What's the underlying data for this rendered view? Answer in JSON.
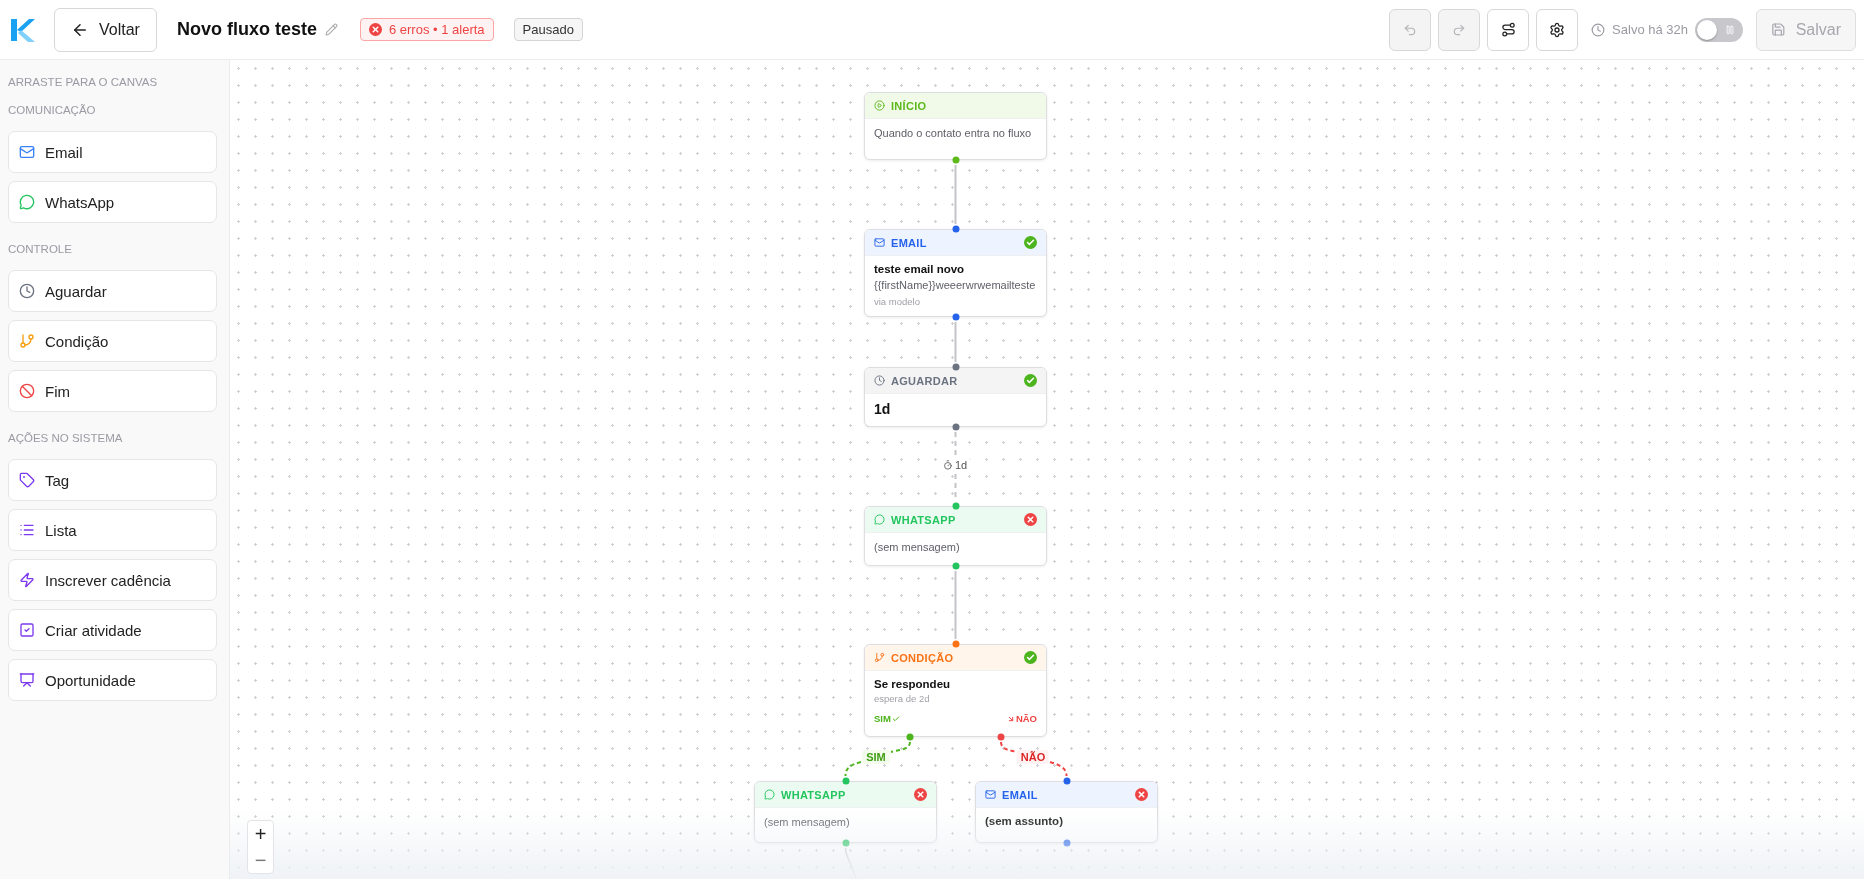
{
  "header": {
    "back_button": "Voltar",
    "title": "Novo fluxo teste",
    "issues_badge": "6 erros • 1 alerta",
    "status_badge": "Pausado",
    "undo_disabled": true,
    "redo_disabled": true,
    "saved_text": "Salvo há 32h",
    "active_toggle": {
      "on": false
    },
    "save_button": {
      "label": "Salvar",
      "disabled": true
    }
  },
  "sidebar": {
    "hint": "ARRASTE PARA O CANVAS",
    "sections": [
      {
        "title": "COMUNICAÇÃO",
        "items": [
          {
            "kind": "email",
            "label": "Email"
          },
          {
            "kind": "whatsapp",
            "label": "WhatsApp"
          }
        ]
      },
      {
        "title": "CONTROLE",
        "items": [
          {
            "kind": "wait",
            "label": "Aguardar"
          },
          {
            "kind": "condition",
            "label": "Condição"
          },
          {
            "kind": "end",
            "label": "Fim"
          }
        ]
      },
      {
        "title": "AÇÕES NO SISTEMA",
        "items": [
          {
            "kind": "tag",
            "label": "Tag"
          },
          {
            "kind": "list",
            "label": "Lista"
          },
          {
            "kind": "cadence",
            "label": "Inscrever cadência"
          },
          {
            "kind": "activity",
            "label": "Criar atividade"
          },
          {
            "kind": "opportunity",
            "label": "Oportunidade"
          }
        ]
      }
    ]
  },
  "nodes": [
    {
      "kind": "start",
      "label": "INÍCIO",
      "text": "Quando o contato entra no fluxo"
    },
    {
      "kind": "email",
      "label": "EMAIL",
      "valid": true,
      "title": "teste email novo",
      "text": "{{firstName}}weeerwrwemailteste",
      "note": "via modelo"
    },
    {
      "kind": "wait",
      "label": "AGUARDAR",
      "valid": true,
      "title": "1d"
    },
    {
      "kind": "whatsapp",
      "label": "WHATSAPP",
      "valid": false,
      "text": "(sem mensagem)"
    },
    {
      "kind": "condition",
      "label": "CONDIÇÃO",
      "valid": true,
      "title": "Se respondeu",
      "note": "espera de 2d",
      "yes": "SIM",
      "no": "NÃO"
    },
    {
      "kind": "whatsapp",
      "label": "WHATSAPP",
      "valid": false,
      "text": "(sem mensagem)"
    },
    {
      "kind": "email",
      "label": "EMAIL",
      "valid": false,
      "title": "(sem assunto)"
    }
  ],
  "connections": [
    {
      "kind": "solid"
    },
    {
      "kind": "solid"
    },
    {
      "kind": "timed",
      "label": "1d"
    },
    {
      "kind": "solid"
    },
    {
      "kind": "yes",
      "label": "SIM"
    },
    {
      "kind": "no",
      "label": "NÃO"
    }
  ],
  "zoom_controls": {
    "zoom_in": "+",
    "zoom_out": "−"
  }
}
